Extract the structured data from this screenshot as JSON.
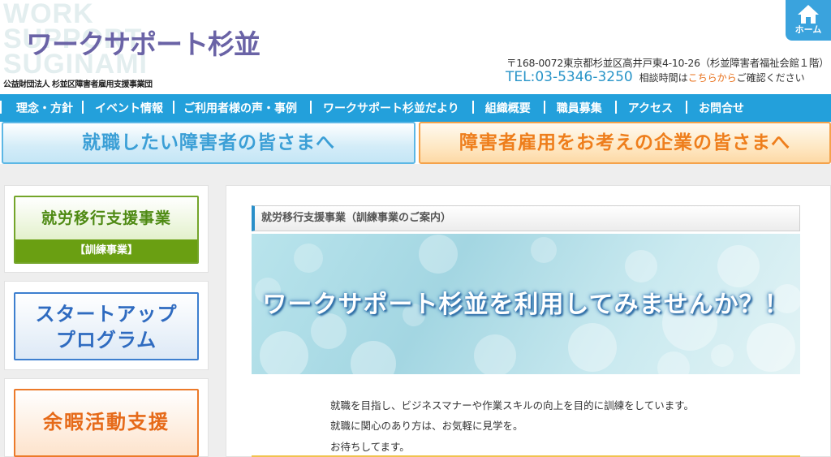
{
  "header": {
    "bg_logo_lines": [
      "WORK",
      "SUPPORT",
      "SUGINAMI"
    ],
    "site_title": "ワークサポート杉並",
    "org_name": "公益財団法人 杉並区障害者雇用支援事業団",
    "home_label": "ホーム",
    "address": "〒168-0072東京都杉並区高井戸東4-10-26（杉並障害者福祉会館１階）",
    "tel": "TEL:03-5346-3250",
    "hours_prefix": "相談時間は",
    "hours_link": "こちらから",
    "hours_suffix": "ご確認ください"
  },
  "nav": {
    "items": [
      {
        "label": "理念・方針"
      },
      {
        "label": "イベント情報"
      },
      {
        "label": "ご利用者様の声・事例"
      },
      {
        "label": "ワークサポート杉並だより"
      },
      {
        "label": "組織概要"
      },
      {
        "label": "職員募集"
      },
      {
        "label": "アクセス"
      },
      {
        "label": "お問合せ"
      }
    ]
  },
  "banners": {
    "job_seekers": "就職したい障害者の皆さまへ",
    "employers": "障害者雇用をお考えの企業の皆さまへ"
  },
  "sidebar": {
    "transition_support": {
      "title": "就労移行支援事業",
      "sub": "【訓練事業】"
    },
    "startup": {
      "line1": "スタートアップ",
      "line2": "プログラム"
    },
    "leisure": {
      "label": "余暇活動支援"
    }
  },
  "main": {
    "heading": "就労移行支援事業（訓練事業のご案内）",
    "hero_text": "ワークサポート杉並を利用してみませんか？！",
    "description": [
      "就職を目指し、ビジネスマナーや作業スキルの向上を目的に訓練をしています。",
      "就職に関心のあり方は、お気軽に見学を。",
      "お待ちしてます。"
    ]
  },
  "colors": {
    "nav_bg": "#23a0db",
    "title": "#6a63a6",
    "accent_orange": "#ee7e1c",
    "accent_green": "#6a9f12",
    "accent_blue": "#2f6bc0"
  }
}
